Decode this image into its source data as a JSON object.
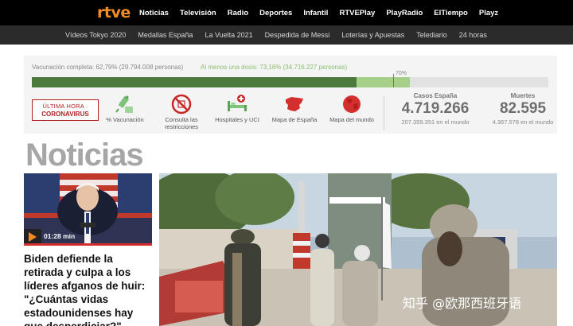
{
  "topbar": {
    "logo": "rtve",
    "items": [
      "Noticias",
      "Televisión",
      "Radio",
      "Deportes",
      "Infantil",
      "RTVEPlay",
      "PlayRadio",
      "ElTiempo",
      "Playz"
    ]
  },
  "subbar": {
    "items": [
      "Vídeos Tokyo 2020",
      "Medallas España",
      "La Vuelta 2021",
      "Despedida de Messi",
      "Loterías y Apuestas",
      "Telediario",
      "24 horas"
    ]
  },
  "vaccination": {
    "complete_label": "Vacunación completa: 62,79% (29.794.008 personas)",
    "one_dose_label": "Al menos una dosis: 73,16% (34.716.227 personas)",
    "complete_percent": 62.79,
    "one_dose_percent": 73.16,
    "target_label": "70%",
    "target_percent": 70
  },
  "covid_tools": {
    "breaking_line1": "ÚLTIMA HORA ·",
    "breaking_line2": "CORONAVIRUS",
    "items": [
      {
        "icon": "syringe-icon",
        "label": "% Vacunación"
      },
      {
        "icon": "prohibited-icon",
        "label": "Consulta las restricciones"
      },
      {
        "icon": "hospital-bed-icon",
        "label": "Hospitales y UCI"
      },
      {
        "icon": "spain-map-icon",
        "label": "Mapa de España"
      },
      {
        "icon": "globe-icon",
        "label": "Mapa del mundo"
      }
    ]
  },
  "stats": {
    "cases_title": "Casos España",
    "cases_value": "4.719.266",
    "cases_world": "207.359.351 en el mundo",
    "deaths_title": "Muertes",
    "deaths_value": "82.595",
    "deaths_world": "4.367.578 en el mundo"
  },
  "section_heading": "Noticias",
  "featured": {
    "duration": "01:28 min",
    "title": "Biden defiende la retirada y culpa a los líderes afganos de huir: \"¿Cuántas vidas estadounidenses hay que desperdiciar?\""
  },
  "watermark": "知乎 @欧那西班牙语",
  "colors": {
    "brand_orange": "#f28c22",
    "alert_red": "#b02323",
    "vaccine_complete": "#4c7a3c",
    "vaccine_one_dose": "#a6d08a"
  }
}
